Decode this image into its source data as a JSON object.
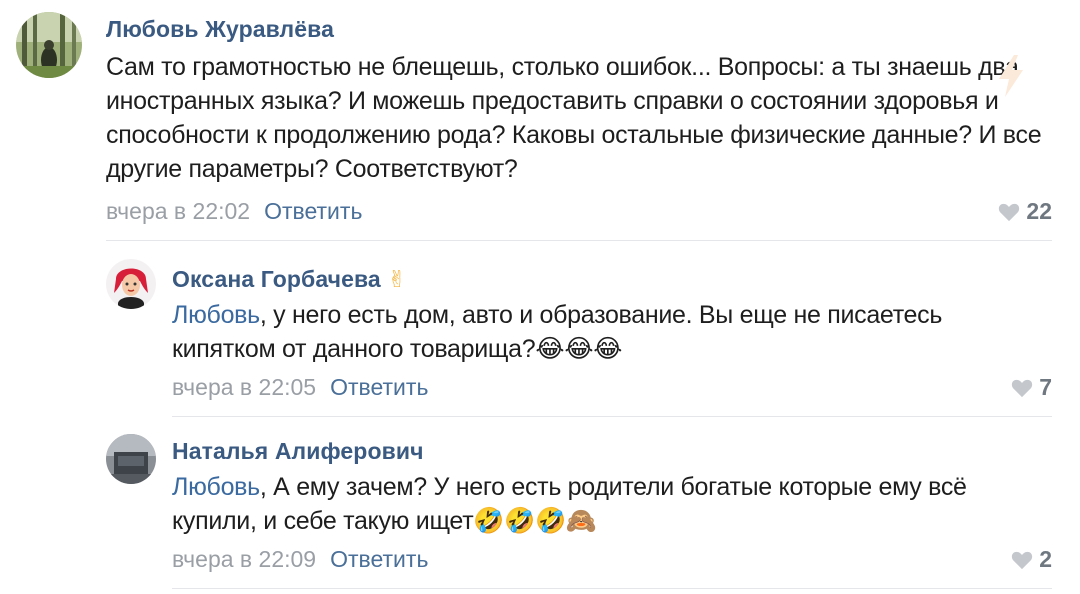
{
  "comments": [
    {
      "author": "Любовь Журавлёва",
      "text": "Сам то грамотностью не блещешь, столько ошибок... Вопросы: а ты знаешь два иностранных языка? И можешь предоставить справки о состоянии здоровья и способности к продолжению рода? Каковы остальные физические данные? И все другие параметры? Соответствуют?",
      "time": "вчера в 22:02",
      "reply_label": "Ответить",
      "likes": "22"
    },
    {
      "author": "Оксана Горбачева",
      "author_emoji": "✌",
      "mention": "Любовь",
      "text": ", у него есть дом, авто и образование. Вы еще не писаетесь кипятком от данного товарища?",
      "emojis": [
        "😂",
        "😂",
        "😂"
      ],
      "time": "вчера в 22:05",
      "reply_label": "Ответить",
      "likes": "7"
    },
    {
      "author": "Наталья Алиферович",
      "mention": "Любовь",
      "text": ", А ему зачем? У него есть родители богатые которые ему всё купили, и себе такую ищет",
      "emojis": [
        "🤣",
        "🤣",
        "🤣",
        "🙈"
      ],
      "time": "вчера в 22:09",
      "reply_label": "Ответить",
      "likes": "2"
    }
  ],
  "icons": {
    "like": "heart-icon",
    "bolt": "bolt-icon"
  },
  "colors": {
    "author": "#3a5a82",
    "link": "#4a6f98",
    "mention": "#3a6aa0",
    "meta": "#9a9fa6",
    "likes": "#6f7780",
    "divider": "#e4e6ea"
  }
}
